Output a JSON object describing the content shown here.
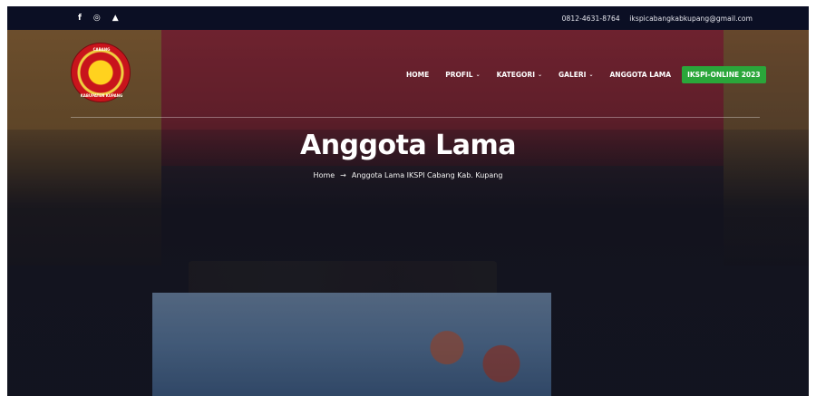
{
  "topbar": {
    "social": [
      {
        "icon": "facebook-icon",
        "glyph": "f"
      },
      {
        "icon": "instagram-icon",
        "glyph": "◎"
      },
      {
        "icon": "youtube-icon",
        "glyph": "▲"
      }
    ],
    "phone": "0812-4631-8764",
    "email": "ikspicabangkabkupang@gmail.com"
  },
  "logo": {
    "text_top": "CABANG",
    "text_bottom": "KABUPATEN KUPANG"
  },
  "nav": {
    "items": [
      {
        "label": "HOME",
        "has_dropdown": false
      },
      {
        "label": "PROFIL",
        "has_dropdown": true
      },
      {
        "label": "KATEGORI",
        "has_dropdown": true
      },
      {
        "label": "GALERI",
        "has_dropdown": true
      },
      {
        "label": "ANGGOTA LAMA",
        "has_dropdown": false
      }
    ],
    "cta_label": "IKSPI-ONLINE 2023",
    "dropdown_glyph": "⌄"
  },
  "hero": {
    "title": "Anggota Lama",
    "breadcrumb_home": "Home",
    "breadcrumb_arrow": "→",
    "breadcrumb_current": "Anggota Lama IKSPI Cabang Kab. Kupang"
  },
  "colors": {
    "topbar_bg": "#0b0f24",
    "cta_bg": "#2aa63a",
    "text": "#ffffff"
  }
}
